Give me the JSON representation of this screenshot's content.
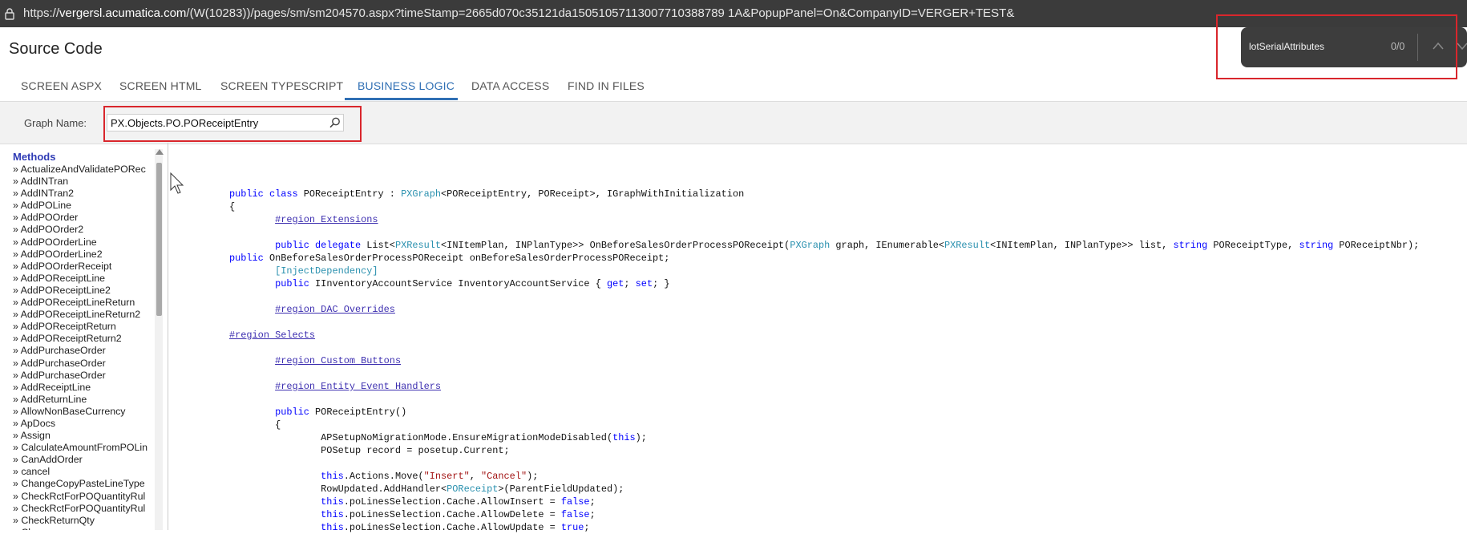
{
  "browser": {
    "url_prefix": "https://",
    "url_host": "vergersl.acumatica.com",
    "url_path": "/(W(10283))/pages/sm/sm204570.aspx?timeStamp=2665d070c35121da15051057113007710388789 1A&PopupPanel=On&CompanyID=VERGER+TEST&"
  },
  "find": {
    "query": "lotSerialAttributes",
    "count": "0/0"
  },
  "page": {
    "title": "Source Code"
  },
  "tabs": [
    {
      "label": "SCREEN ASPX"
    },
    {
      "label": "SCREEN HTML"
    },
    {
      "label": "SCREEN TYPESCRIPT"
    },
    {
      "label": "BUSINESS LOGIC"
    },
    {
      "label": "DATA ACCESS"
    },
    {
      "label": "FIND IN FILES"
    }
  ],
  "active_tab": "BUSINESS LOGIC",
  "form": {
    "graph_label": "Graph Name:",
    "graph_value": "PX.Objects.PO.POReceiptEntry"
  },
  "methods": {
    "title": "Methods",
    "items": [
      "» ActualizeAndValidatePORec",
      "» AddINTran",
      "» AddINTran2",
      "» AddPOLine",
      "» AddPOOrder",
      "» AddPOOrder2",
      "» AddPOOrderLine",
      "» AddPOOrderLine2",
      "» AddPOOrderReceipt",
      "» AddPOReceiptLine",
      "» AddPOReceiptLine2",
      "» AddPOReceiptLineReturn",
      "» AddPOReceiptLineReturn2",
      "» AddPOReceiptReturn",
      "» AddPOReceiptReturn2",
      "» AddPurchaseOrder",
      "» AddPurchaseOrder",
      "» AddPurchaseOrder",
      "» AddReceiptLine",
      "» AddReturnLine",
      "» AllowNonBaseCurrency",
      "» ApDocs",
      "» Assign",
      "» CalculateAmountFromPOLin",
      "» CanAddOrder",
      "» cancel",
      "» ChangeCopyPasteLineType",
      "» CheckRctForPOQuantityRul",
      "» CheckRctForPOQuantityRul",
      "» CheckReturnQty",
      "» Clear"
    ]
  },
  "code": {
    "lines": [
      [
        {
          "t": "public class ",
          "c": "kw"
        },
        {
          "t": "POReceiptEntry : "
        },
        {
          "t": "PXGraph",
          "c": "ty"
        },
        {
          "t": "<POReceiptEntry, POReceipt>, IGraphWithInitialization"
        }
      ],
      [
        {
          "t": "{"
        }
      ],
      [
        {
          "t": "        "
        },
        {
          "t": "#region Extensions",
          "c": "rg"
        }
      ],
      [],
      [
        {
          "t": "        "
        },
        {
          "t": "public delegate ",
          "c": "kw"
        },
        {
          "t": "List<"
        },
        {
          "t": "PXResult",
          "c": "ty"
        },
        {
          "t": "<INItemPlan, INPlanType>> OnBeforeSalesOrderProcessPOReceipt("
        },
        {
          "t": "PXGraph",
          "c": "ty"
        },
        {
          "t": " graph, IEnumerable<"
        },
        {
          "t": "PXResult",
          "c": "ty"
        },
        {
          "t": "<INItemPlan, INPlanType>> list, "
        },
        {
          "t": "string",
          "c": "kw"
        },
        {
          "t": " POReceiptType, "
        },
        {
          "t": "string",
          "c": "kw"
        },
        {
          "t": " POReceiptNbr);"
        }
      ],
      [
        {
          "t": "public ",
          "c": "kw"
        },
        {
          "t": "OnBeforeSalesOrderProcessPOReceipt onBeforeSalesOrderProcessPOReceipt;"
        }
      ],
      [
        {
          "t": "        [InjectDependency]",
          "c": "ty"
        }
      ],
      [
        {
          "t": "        "
        },
        {
          "t": "public ",
          "c": "kw"
        },
        {
          "t": "IInventoryAccountService InventoryAccountService { "
        },
        {
          "t": "get",
          "c": "kw"
        },
        {
          "t": "; "
        },
        {
          "t": "set",
          "c": "kw"
        },
        {
          "t": "; }"
        }
      ],
      [],
      [
        {
          "t": "        "
        },
        {
          "t": "#region DAC Overrides",
          "c": "rg"
        }
      ],
      [],
      [
        {
          "t": "#region Selects",
          "c": "rg"
        }
      ],
      [],
      [
        {
          "t": "        "
        },
        {
          "t": "#region Custom Buttons",
          "c": "rg"
        }
      ],
      [],
      [
        {
          "t": "        "
        },
        {
          "t": "#region Entity Event Handlers",
          "c": "rg"
        }
      ],
      [],
      [
        {
          "t": "        "
        },
        {
          "t": "public ",
          "c": "kw"
        },
        {
          "t": "POReceiptEntry()"
        }
      ],
      [
        {
          "t": "        {"
        }
      ],
      [
        {
          "t": "                APSetupNoMigrationMode.EnsureMigrationModeDisabled("
        },
        {
          "t": "this",
          "c": "kw"
        },
        {
          "t": ");"
        }
      ],
      [
        {
          "t": "                POSetup record = posetup.Current;"
        }
      ],
      [],
      [
        {
          "t": "                "
        },
        {
          "t": "this",
          "c": "kw"
        },
        {
          "t": ".Actions.Move("
        },
        {
          "t": "\"Insert\"",
          "c": "st"
        },
        {
          "t": ", "
        },
        {
          "t": "\"Cancel\"",
          "c": "st"
        },
        {
          "t": ");"
        }
      ],
      [
        {
          "t": "                RowUpdated.AddHandler<"
        },
        {
          "t": "POReceipt",
          "c": "ty"
        },
        {
          "t": ">(ParentFieldUpdated);"
        }
      ],
      [
        {
          "t": "                "
        },
        {
          "t": "this",
          "c": "kw"
        },
        {
          "t": ".poLinesSelection.Cache.AllowInsert = "
        },
        {
          "t": "false",
          "c": "kw"
        },
        {
          "t": ";"
        }
      ],
      [
        {
          "t": "                "
        },
        {
          "t": "this",
          "c": "kw"
        },
        {
          "t": ".poLinesSelection.Cache.AllowDelete = "
        },
        {
          "t": "false",
          "c": "kw"
        },
        {
          "t": ";"
        }
      ],
      [
        {
          "t": "                "
        },
        {
          "t": "this",
          "c": "kw"
        },
        {
          "t": ".poLinesSelection.Cache.AllowUpdate = "
        },
        {
          "t": "true",
          "c": "kw"
        },
        {
          "t": ";"
        }
      ]
    ]
  },
  "colors": {
    "accent": "#2f6fb4",
    "highlight_border": "#d9262c",
    "keyword": "#0000ff",
    "type": "#2b91af",
    "string": "#a31515",
    "region": "#3d2fb0"
  }
}
